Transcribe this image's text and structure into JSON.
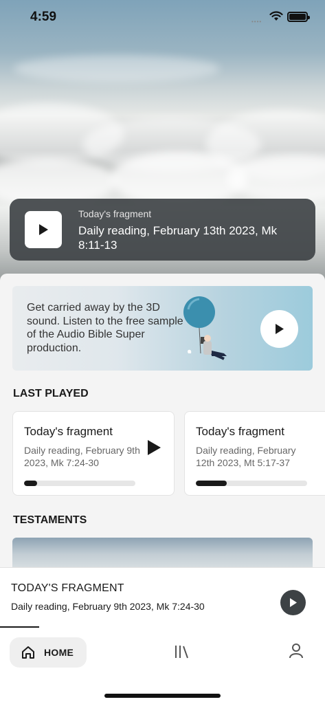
{
  "status_bar": {
    "time": "4:59",
    "signal": "••••"
  },
  "todays_fragment_card": {
    "label": "Today's fragment",
    "title": "Daily reading, February 13th 2023, Mk 8:11-13",
    "icon": "play-icon"
  },
  "promo": {
    "text": "Get carried away by the 3D sound. Listen to the free sample of the Audio Bible Super production.",
    "icon": "play-icon"
  },
  "last_played": {
    "heading": "LAST PLAYED",
    "items": [
      {
        "title": "Today's fragment",
        "subtitle": "Daily reading, February 9th 2023, Mk 7:24-30",
        "progress": 0.12
      },
      {
        "title": "Today's fragment",
        "subtitle": "Daily reading, February 12th 2023, Mt 5:17-37",
        "progress": 0.28
      }
    ]
  },
  "testaments": {
    "heading": "TESTAMENTS"
  },
  "mini_player": {
    "label": "TODAY'S FRAGMENT",
    "title": "Daily reading, February 9th 2023, Mk 7:24-30",
    "progress": 0.12
  },
  "tab_bar": {
    "home_label": "HOME",
    "items": [
      "home-icon",
      "library-icon",
      "profile-icon"
    ]
  },
  "colors": {
    "dark_card": "#3c4044",
    "accent_light_blue": "#9ccbdc",
    "text_primary": "#1a1a1a"
  }
}
